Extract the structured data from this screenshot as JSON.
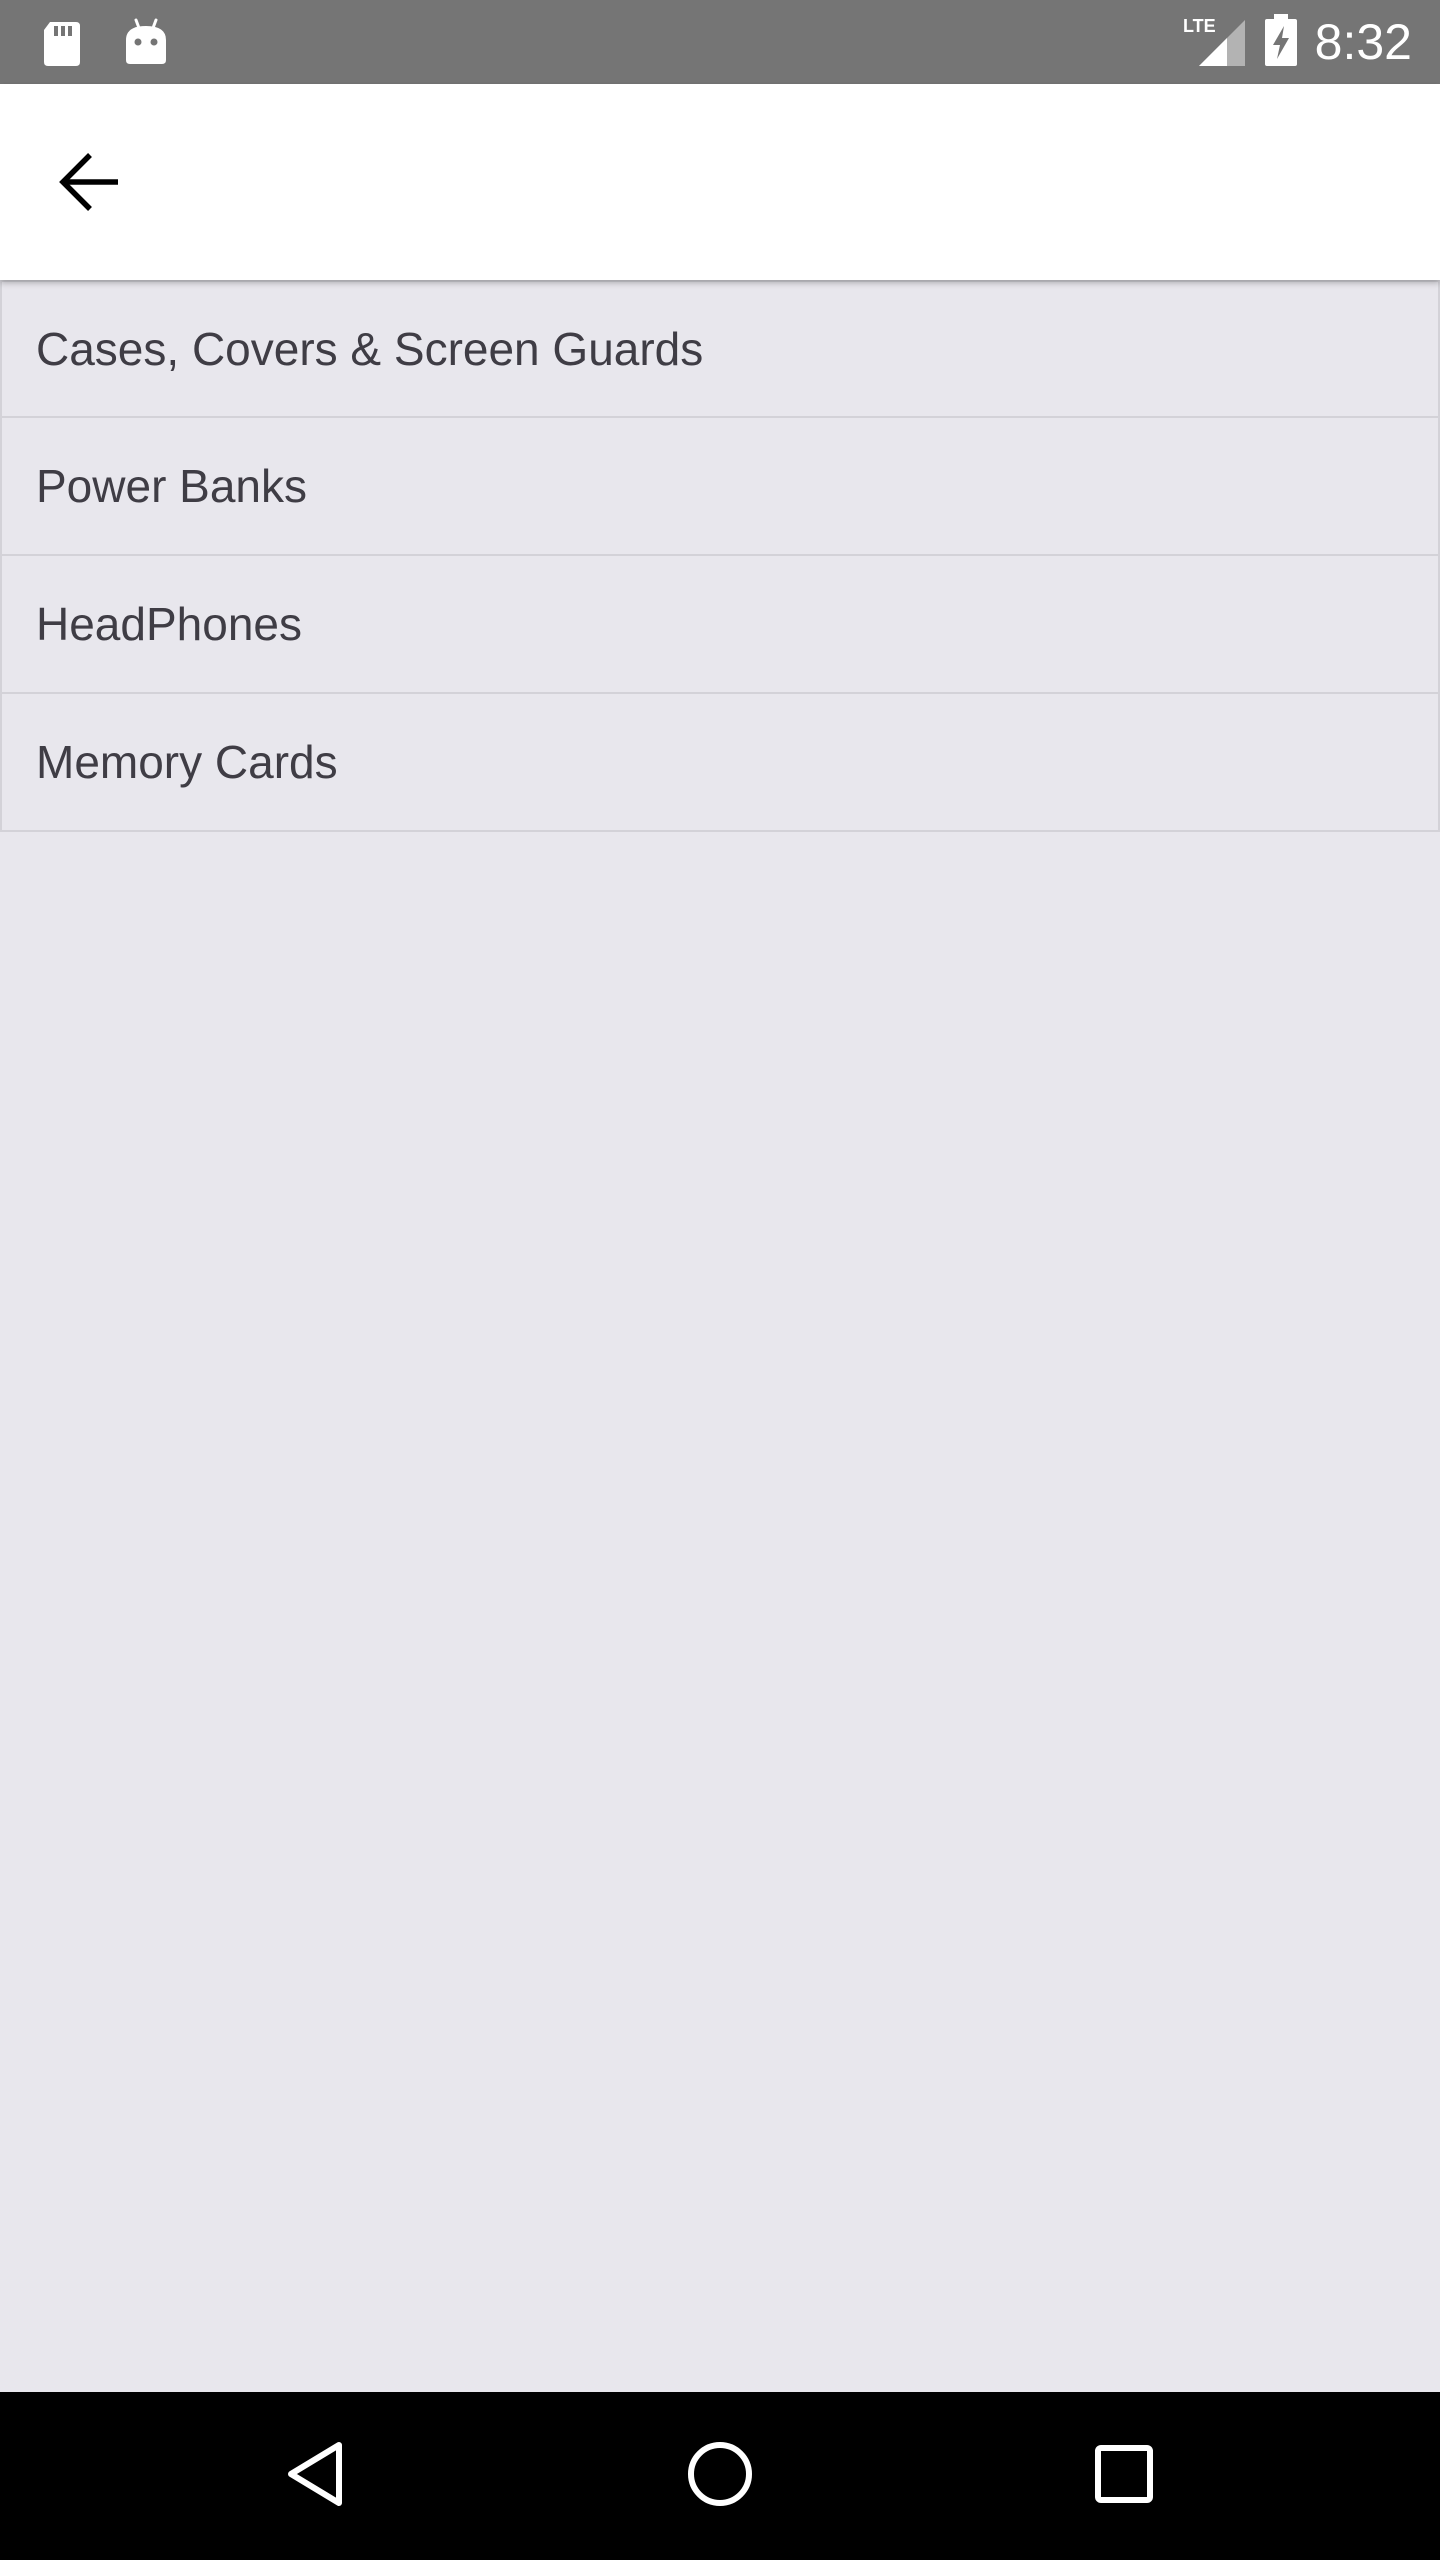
{
  "status_bar": {
    "time": "8:32",
    "network_label": "LTE",
    "icons": [
      "sd-card-icon",
      "android-icon",
      "lte-signal-icon",
      "battery-charging-icon"
    ]
  },
  "app_bar": {
    "back_icon": "arrow-back-icon"
  },
  "categories": [
    {
      "label": "Cases, Covers & Screen Guards"
    },
    {
      "label": "Power Banks"
    },
    {
      "label": "HeadPhones"
    },
    {
      "label": "Memory Cards"
    }
  ],
  "nav_bar": {
    "icons": [
      "nav-back-icon",
      "nav-home-icon",
      "nav-recents-icon"
    ]
  },
  "colors": {
    "status_bar": "#757575",
    "app_bar": "#ffffff",
    "background": "#e8e7ed",
    "divider": "#d3d2d8",
    "text": "#3f3d45",
    "nav_bar": "#000000"
  }
}
